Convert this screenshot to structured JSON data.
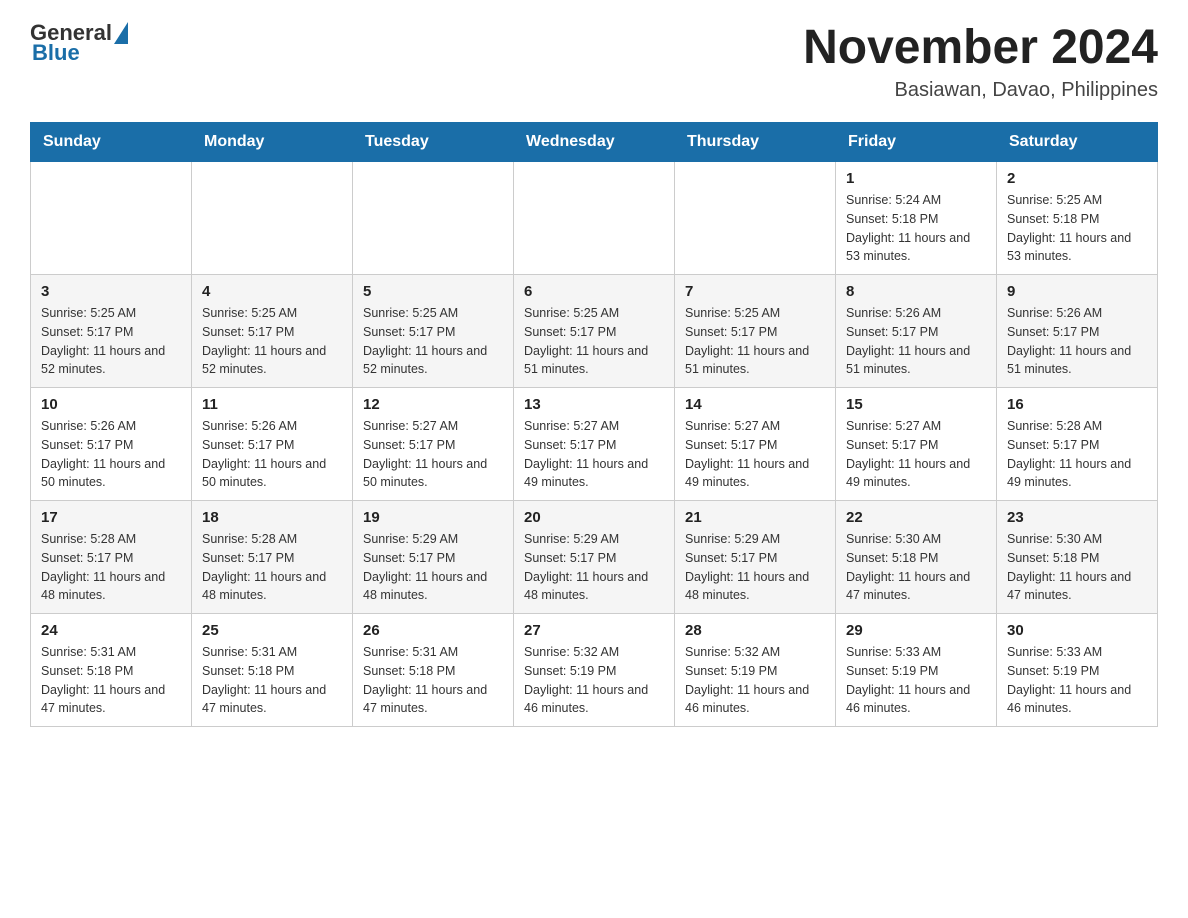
{
  "header": {
    "logo": {
      "general": "General",
      "blue": "Blue"
    },
    "title": "November 2024",
    "location": "Basiawan, Davao, Philippines"
  },
  "days_of_week": [
    "Sunday",
    "Monday",
    "Tuesday",
    "Wednesday",
    "Thursday",
    "Friday",
    "Saturday"
  ],
  "weeks": [
    [
      {
        "day": "",
        "info": ""
      },
      {
        "day": "",
        "info": ""
      },
      {
        "day": "",
        "info": ""
      },
      {
        "day": "",
        "info": ""
      },
      {
        "day": "",
        "info": ""
      },
      {
        "day": "1",
        "info": "Sunrise: 5:24 AM\nSunset: 5:18 PM\nDaylight: 11 hours and 53 minutes."
      },
      {
        "day": "2",
        "info": "Sunrise: 5:25 AM\nSunset: 5:18 PM\nDaylight: 11 hours and 53 minutes."
      }
    ],
    [
      {
        "day": "3",
        "info": "Sunrise: 5:25 AM\nSunset: 5:17 PM\nDaylight: 11 hours and 52 minutes."
      },
      {
        "day": "4",
        "info": "Sunrise: 5:25 AM\nSunset: 5:17 PM\nDaylight: 11 hours and 52 minutes."
      },
      {
        "day": "5",
        "info": "Sunrise: 5:25 AM\nSunset: 5:17 PM\nDaylight: 11 hours and 52 minutes."
      },
      {
        "day": "6",
        "info": "Sunrise: 5:25 AM\nSunset: 5:17 PM\nDaylight: 11 hours and 51 minutes."
      },
      {
        "day": "7",
        "info": "Sunrise: 5:25 AM\nSunset: 5:17 PM\nDaylight: 11 hours and 51 minutes."
      },
      {
        "day": "8",
        "info": "Sunrise: 5:26 AM\nSunset: 5:17 PM\nDaylight: 11 hours and 51 minutes."
      },
      {
        "day": "9",
        "info": "Sunrise: 5:26 AM\nSunset: 5:17 PM\nDaylight: 11 hours and 51 minutes."
      }
    ],
    [
      {
        "day": "10",
        "info": "Sunrise: 5:26 AM\nSunset: 5:17 PM\nDaylight: 11 hours and 50 minutes."
      },
      {
        "day": "11",
        "info": "Sunrise: 5:26 AM\nSunset: 5:17 PM\nDaylight: 11 hours and 50 minutes."
      },
      {
        "day": "12",
        "info": "Sunrise: 5:27 AM\nSunset: 5:17 PM\nDaylight: 11 hours and 50 minutes."
      },
      {
        "day": "13",
        "info": "Sunrise: 5:27 AM\nSunset: 5:17 PM\nDaylight: 11 hours and 49 minutes."
      },
      {
        "day": "14",
        "info": "Sunrise: 5:27 AM\nSunset: 5:17 PM\nDaylight: 11 hours and 49 minutes."
      },
      {
        "day": "15",
        "info": "Sunrise: 5:27 AM\nSunset: 5:17 PM\nDaylight: 11 hours and 49 minutes."
      },
      {
        "day": "16",
        "info": "Sunrise: 5:28 AM\nSunset: 5:17 PM\nDaylight: 11 hours and 49 minutes."
      }
    ],
    [
      {
        "day": "17",
        "info": "Sunrise: 5:28 AM\nSunset: 5:17 PM\nDaylight: 11 hours and 48 minutes."
      },
      {
        "day": "18",
        "info": "Sunrise: 5:28 AM\nSunset: 5:17 PM\nDaylight: 11 hours and 48 minutes."
      },
      {
        "day": "19",
        "info": "Sunrise: 5:29 AM\nSunset: 5:17 PM\nDaylight: 11 hours and 48 minutes."
      },
      {
        "day": "20",
        "info": "Sunrise: 5:29 AM\nSunset: 5:17 PM\nDaylight: 11 hours and 48 minutes."
      },
      {
        "day": "21",
        "info": "Sunrise: 5:29 AM\nSunset: 5:17 PM\nDaylight: 11 hours and 48 minutes."
      },
      {
        "day": "22",
        "info": "Sunrise: 5:30 AM\nSunset: 5:18 PM\nDaylight: 11 hours and 47 minutes."
      },
      {
        "day": "23",
        "info": "Sunrise: 5:30 AM\nSunset: 5:18 PM\nDaylight: 11 hours and 47 minutes."
      }
    ],
    [
      {
        "day": "24",
        "info": "Sunrise: 5:31 AM\nSunset: 5:18 PM\nDaylight: 11 hours and 47 minutes."
      },
      {
        "day": "25",
        "info": "Sunrise: 5:31 AM\nSunset: 5:18 PM\nDaylight: 11 hours and 47 minutes."
      },
      {
        "day": "26",
        "info": "Sunrise: 5:31 AM\nSunset: 5:18 PM\nDaylight: 11 hours and 47 minutes."
      },
      {
        "day": "27",
        "info": "Sunrise: 5:32 AM\nSunset: 5:19 PM\nDaylight: 11 hours and 46 minutes."
      },
      {
        "day": "28",
        "info": "Sunrise: 5:32 AM\nSunset: 5:19 PM\nDaylight: 11 hours and 46 minutes."
      },
      {
        "day": "29",
        "info": "Sunrise: 5:33 AM\nSunset: 5:19 PM\nDaylight: 11 hours and 46 minutes."
      },
      {
        "day": "30",
        "info": "Sunrise: 5:33 AM\nSunset: 5:19 PM\nDaylight: 11 hours and 46 minutes."
      }
    ]
  ]
}
